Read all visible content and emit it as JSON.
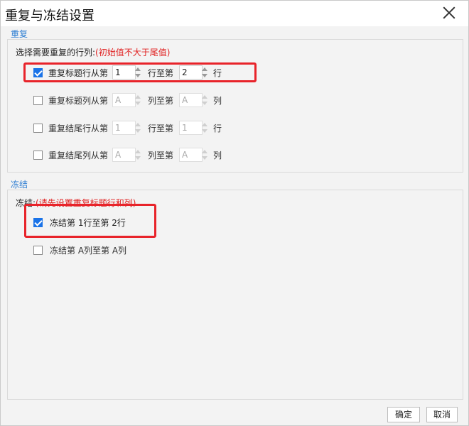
{
  "dialog": {
    "title": "重复与冻结设置",
    "ok_label": "确定",
    "cancel_label": "取消"
  },
  "repeat": {
    "section_label": "重复",
    "prompt": "选择需要重复的行列:",
    "hint": "(初始值不大于尾值)",
    "rows": [
      {
        "checked": true,
        "label": "重复标题行从第",
        "from": "1",
        "mid": "行至第",
        "to": "2",
        "unit": "行",
        "enabled": true
      },
      {
        "checked": false,
        "label": "重复标题列从第",
        "from": "A",
        "mid": "列至第",
        "to": "A",
        "unit": "列",
        "enabled": false
      },
      {
        "checked": false,
        "label": "重复结尾行从第",
        "from": "1",
        "mid": "行至第",
        "to": "1",
        "unit": "行",
        "enabled": false
      },
      {
        "checked": false,
        "label": "重复结尾列从第",
        "from": "A",
        "mid": "列至第",
        "to": "A",
        "unit": "列",
        "enabled": false
      }
    ]
  },
  "freeze": {
    "section_label": "冻结",
    "prompt": "冻结:",
    "hint": "(请先设置重复标题行和列)",
    "rows": [
      {
        "checked": true,
        "label": "冻结第  1行至第 2行"
      },
      {
        "checked": false,
        "label": "冻结第  A列至第  A列"
      }
    ]
  },
  "colors": {
    "accent": "#2f7fd3",
    "hint": "#e02020",
    "highlight": "#e8232a",
    "checkbox": "#1a73e8"
  }
}
